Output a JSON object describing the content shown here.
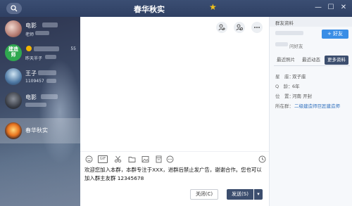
{
  "title_bar": {
    "title": "春华秋实",
    "star_icon": "star-icon",
    "controls": [
      "minimize-icon",
      "maximize-icon",
      "close-icon"
    ]
  },
  "sidebar": {
    "contacts": [
      {
        "name": "电影",
        "message": "老师",
        "time": "",
        "active": false
      },
      {
        "name": "",
        "avatar_text": "建造师",
        "message": "昨天半子",
        "time": "55",
        "active": false
      },
      {
        "name": "王子",
        "message": "1109457",
        "time": "",
        "active": false
      },
      {
        "name": "电影",
        "message": "",
        "time": "",
        "active": false
      },
      {
        "name": "春华秋实",
        "message": "",
        "time": "",
        "active": true
      }
    ]
  },
  "chat": {
    "top_buttons": [
      "add-member-icon",
      "members-icon",
      "more-icon"
    ],
    "toolbar_icons": [
      "emoji-icon",
      "gif-icon",
      "scissors-icon",
      "folder-icon",
      "image-icon",
      "file-icon",
      "more-tools-icon",
      "history-icon"
    ],
    "gif_label": "GIF",
    "compose_text": "欢迎您加入本群，本群专注于XXX，进群后禁止发广告，谢谢合作。您也可以加入群主友群 12345678",
    "close_label": "关闭(C)",
    "send_label": "发送(S)"
  },
  "panel": {
    "header": "群友资料",
    "add_friend_label": "+ 好友",
    "subtitle": "问好友",
    "tabs": [
      "最近照片",
      "最近动态",
      "更多资料"
    ],
    "active_tab": 2,
    "info": [
      {
        "label": "星　座：",
        "value": "双子座",
        "link": false
      },
      {
        "label": "Q　龄：",
        "value": "6年",
        "link": false
      },
      {
        "label": "位　置：",
        "value": "河南 开封",
        "link": false
      },
      {
        "label": "所在群：",
        "value": "二级建造师巨匠建造师",
        "link": true
      }
    ]
  },
  "colors": {
    "title_bar": "#34466a",
    "send_button": "#3c4e6e",
    "add_friend": "#3a8ee6",
    "active_tab": "#3c4e6e"
  }
}
